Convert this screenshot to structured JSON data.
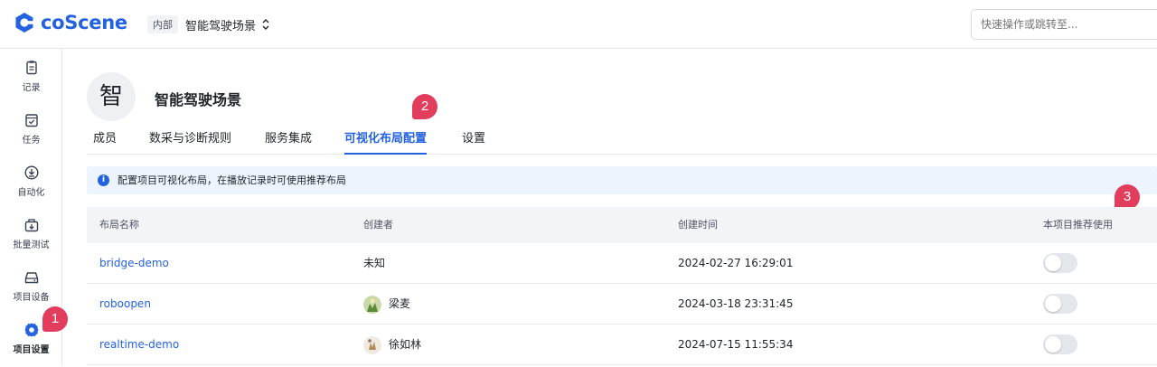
{
  "brand": {
    "name": "coScene",
    "color": "#2462e0"
  },
  "header": {
    "scope_tag": "内部",
    "project_name": "智能驾驶场景",
    "search_placeholder": "快速操作或跳转至..."
  },
  "sidebar": {
    "items": [
      {
        "label": "记录",
        "icon": "record-icon"
      },
      {
        "label": "任务",
        "icon": "task-icon"
      },
      {
        "label": "自动化",
        "icon": "automation-icon"
      },
      {
        "label": "批量测试",
        "icon": "batch-test-icon"
      },
      {
        "label": "项目设备",
        "icon": "device-icon"
      },
      {
        "label": "项目设置",
        "icon": "gear-icon",
        "active": true
      }
    ]
  },
  "project": {
    "avatar_char": "智",
    "title": "智能驾驶场景"
  },
  "tabs": [
    {
      "label": "成员"
    },
    {
      "label": "数采与诊断规则"
    },
    {
      "label": "服务集成"
    },
    {
      "label": "可视化布局配置",
      "active": true
    },
    {
      "label": "设置"
    }
  ],
  "info_text": "配置项目可视化布局，在播放记录时可使用推荐布局",
  "table": {
    "columns": [
      "布局名称",
      "创建者",
      "创建时间",
      "本项目推荐使用"
    ],
    "rows": [
      {
        "name": "bridge-demo",
        "creator": "未知",
        "created": "2024-02-27 16:29:01",
        "recommended": false
      },
      {
        "name": "roboopen",
        "creator": "梁麦",
        "created": "2024-03-18 23:31:45",
        "recommended": false
      },
      {
        "name": "realtime-demo",
        "creator": "徐如林",
        "created": "2024-07-15 11:55:34",
        "recommended": false
      }
    ]
  },
  "annotations": [
    "1",
    "2",
    "3"
  ],
  "colors": {
    "accent": "#2462e0",
    "badge": "#e23d5d",
    "info_bg": "#eef4fe"
  }
}
